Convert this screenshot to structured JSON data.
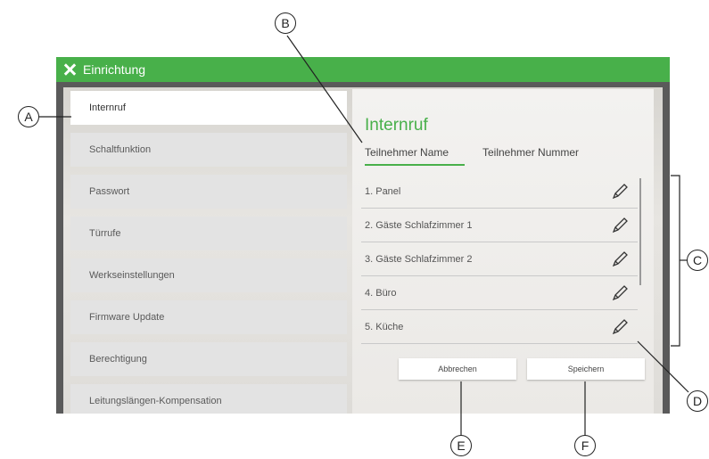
{
  "window": {
    "title": "Einrichtung"
  },
  "sidebar": {
    "items": [
      {
        "label": "Internruf",
        "active": true
      },
      {
        "label": "Schaltfunktion"
      },
      {
        "label": "Passwort"
      },
      {
        "label": "Türrufe"
      },
      {
        "label": "Werkseinstellungen"
      },
      {
        "label": "Firmware Update"
      },
      {
        "label": "Berechtigung"
      },
      {
        "label": "Leitungslängen-Kompensation"
      }
    ]
  },
  "main": {
    "title": "Internruf",
    "tabs": [
      {
        "label": "Teilnehmer Name",
        "active": true
      },
      {
        "label": "Teilnehmer Nummer"
      }
    ],
    "entries": [
      {
        "label": "1. Panel",
        "icon": "pencil-icon"
      },
      {
        "label": "2. Gäste Schlafzimmer 1",
        "icon": "pencil-icon"
      },
      {
        "label": "3. Gäste Schlafzimmer 2",
        "icon": "pencil-icon"
      },
      {
        "label": "4. Büro",
        "icon": "pencil-icon"
      },
      {
        "label": "5. Küche",
        "icon": "pencil-icon"
      }
    ],
    "buttons": {
      "cancel": "Abbrechen",
      "save": "Speichern"
    }
  },
  "callouts": {
    "a": "A",
    "b": "B",
    "c": "C",
    "d": "D",
    "e": "E",
    "f": "F"
  },
  "colors": {
    "accent": "#48b04a",
    "text": "#555555",
    "panel": "#f3f2f0"
  }
}
